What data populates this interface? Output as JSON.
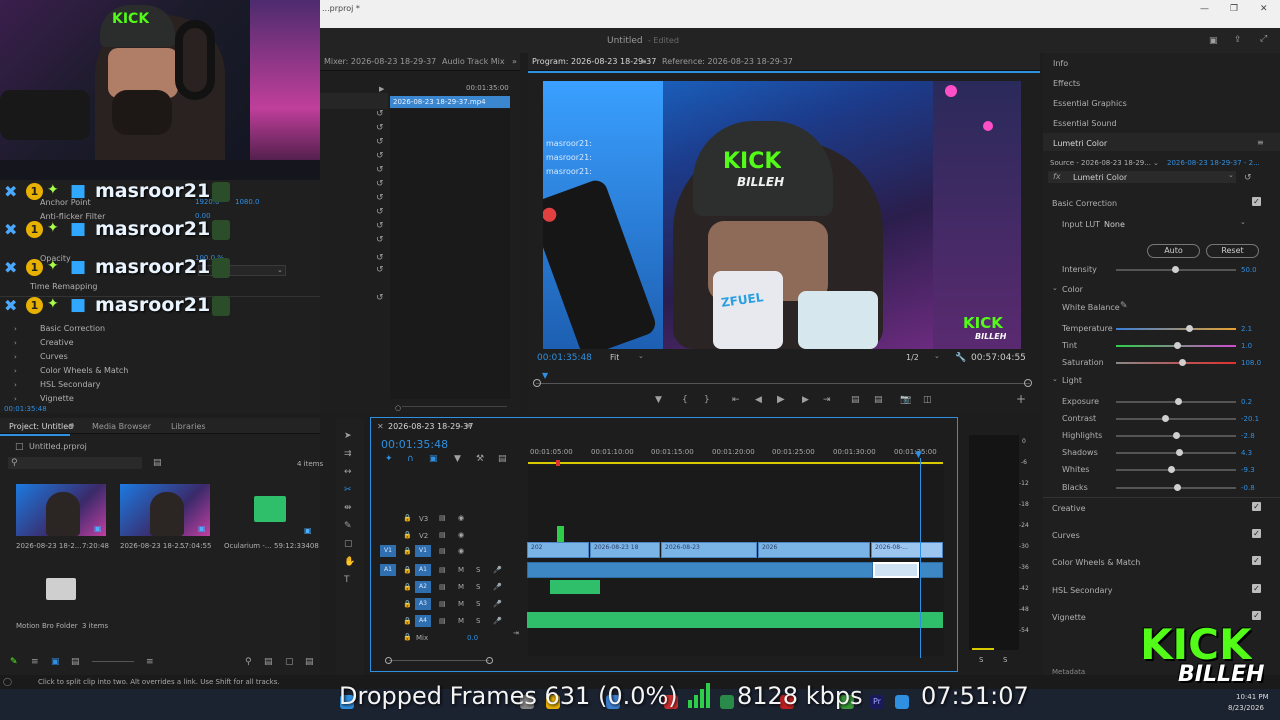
{
  "window": {
    "file_title": "...prproj *",
    "project_title": "Untitled",
    "edited_label": "- Edited"
  },
  "source_panel": {
    "tabs": [
      "Mixer: 2026-08-23 18-29-37",
      "Audio Track Mix"
    ],
    "timecode": "00:01:35:00",
    "clip_name": "2026-08-23 18-29-37.mp4",
    "effect_rows": [
      "Anchor Point",
      "Anti-flicker Filter",
      "Opacity",
      "Time Remapping",
      "Basic Correction",
      "Creative",
      "Curves",
      "Color Wheels & Match",
      "HSL Secondary",
      "Vignette"
    ],
    "anchor_values": [
      "1920.0",
      "1080.0"
    ],
    "antiflicker_value": "0.00",
    "opacity_value": "100.0 %",
    "current_time": "00:01:35:48"
  },
  "program": {
    "tab_program": "Program: 2026-08-23 18-29-37",
    "tab_reference": "Reference: 2026-08-23 18-29-37",
    "timecode": "00:01:35:48",
    "fit": "Fit",
    "quality": "1/2",
    "duration": "00:57:04:55",
    "logo_top": "KICK",
    "logo_bottom": "BILLEH",
    "cap_text": "KICK BILLEH",
    "can_text": "ZFUEL"
  },
  "right_panel": {
    "sections": [
      "Info",
      "Effects",
      "Essential Graphics",
      "Essential Sound",
      "Lumetri Color"
    ],
    "source_label": "Source - 2026-08-23 18-29...",
    "source_clip": "2026-08-23 18-29-37 - 2...",
    "fx_name": "Lumetri Color",
    "basic_correction": "Basic Correction",
    "input_lut_label": "Input LUT",
    "input_lut_value": "None",
    "auto": "Auto",
    "reset": "Reset",
    "intensity_label": "Intensity",
    "intensity_value": "50.0",
    "color_label": "Color",
    "white_balance": "White Balance",
    "light_label": "Light",
    "sliders": [
      {
        "label": "Temperature",
        "value": "2.1",
        "pos": 0.6
      },
      {
        "label": "Tint",
        "value": "1.0",
        "pos": 0.5
      },
      {
        "label": "Saturation",
        "value": "108.0",
        "pos": 0.54
      },
      {
        "label": "Exposure",
        "value": "0.2",
        "pos": 0.51
      },
      {
        "label": "Contrast",
        "value": "-20.1",
        "pos": 0.4
      },
      {
        "label": "Highlights",
        "value": "-2.8",
        "pos": 0.49
      },
      {
        "label": "Shadows",
        "value": "4.3",
        "pos": 0.52
      },
      {
        "label": "Whites",
        "value": "-9.3",
        "pos": 0.45
      },
      {
        "label": "Blacks",
        "value": "-0.8",
        "pos": 0.5
      }
    ],
    "bottom_sections": [
      "Creative",
      "Curves",
      "Color Wheels & Match",
      "HSL Secondary",
      "Vignette"
    ],
    "metadata": "Metadata"
  },
  "project": {
    "tabs": [
      "Project: Untitled",
      "Media Browser",
      "Libraries"
    ],
    "file": "Untitled.prproj",
    "items_count": "4 items",
    "bins": [
      {
        "name": "2026-08-23 18-2...",
        "duration": "7:20:48"
      },
      {
        "name": "2026-08-23 18-2...",
        "duration": "57:04:55"
      },
      {
        "name": "Ocularium -...",
        "duration": "59:12:33408"
      }
    ],
    "folder_name": "Motion Bro Folder",
    "folder_count": "3 items"
  },
  "timeline": {
    "tab": "2026-08-23 18-29-37",
    "timecode": "00:01:35:48",
    "ruler": [
      "00:01:05:00",
      "00:01:10:00",
      "00:01:15:00",
      "00:01:20:00",
      "00:01:25:00",
      "00:01:30:00",
      "00:01:35:00"
    ],
    "video_tracks": [
      "V3",
      "V2",
      "V1"
    ],
    "audio_tracks": [
      "A1",
      "A2",
      "A3",
      "A4"
    ],
    "mix_label": "Mix",
    "mix_value": "0.0",
    "clip_labels": [
      "202",
      "2026-08-23 18",
      "2026-08-23",
      "2026",
      "2026-08-..."
    ],
    "meter_scale": [
      "0",
      "-6",
      "-12",
      "-18",
      "-24",
      "-30",
      "-36",
      "-42",
      "-48",
      "-54"
    ],
    "meter_solo": [
      "S",
      "S"
    ]
  },
  "status_bar": {
    "text": "Click to split clip into two. Alt overrides a link. Use Shift for all tracks."
  },
  "stream_overlay": {
    "chat_user": "masroor21:",
    "chat_rows": 4,
    "dropped_frames": "Dropped Frames 631 (0.0%)",
    "bitrate": "8128 kbps",
    "uptime": "07:51:07",
    "logo_top": "KICK",
    "logo_bottom": "BILLEH"
  },
  "taskbar": {
    "time": "10:41 PM",
    "date": "8/23/2026"
  },
  "colors": {
    "accent_blue": "#2f8fe0",
    "kick_green": "#53fc18",
    "clip_video": "#7ab3e6",
    "clip_audio": "#3c87c4",
    "clip_green_audio": "#2fbf6a"
  }
}
